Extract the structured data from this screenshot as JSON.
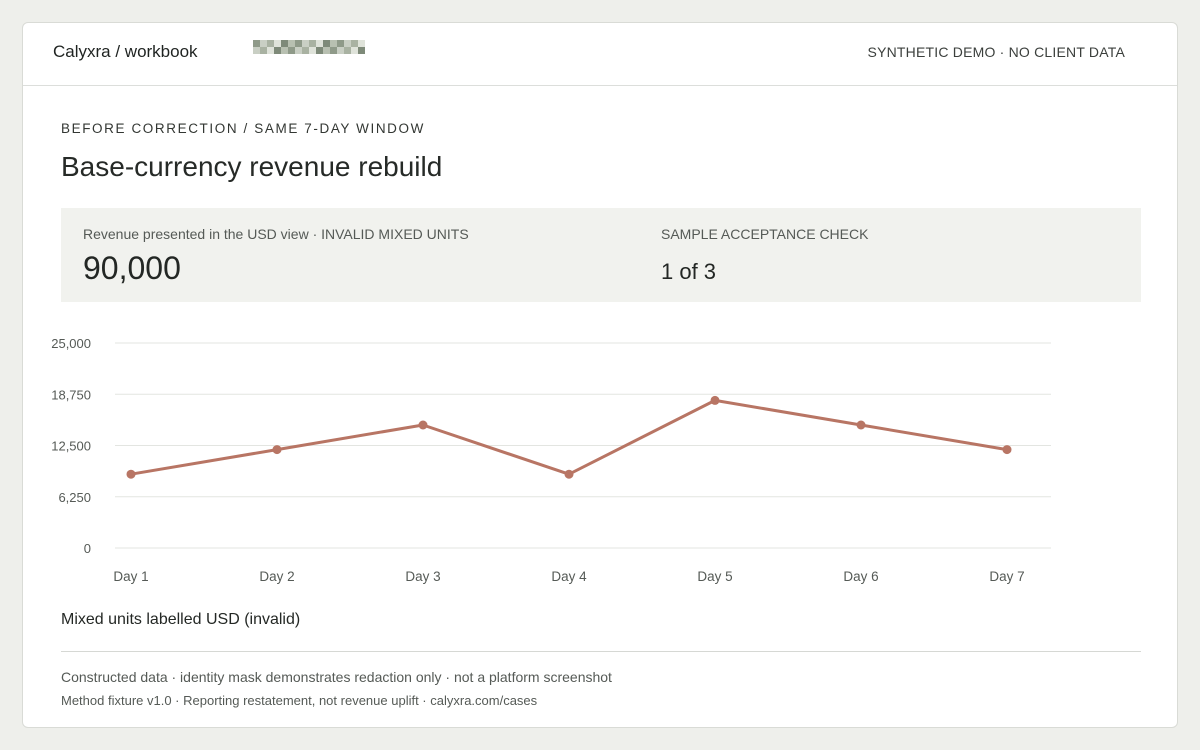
{
  "header": {
    "breadcrumb": "Calyxra / workbook",
    "badge": "SYNTHETIC DEMO · NO CLIENT DATA"
  },
  "page": {
    "eyebrow": "BEFORE CORRECTION / SAME 7-DAY WINDOW",
    "title": "Base-currency revenue rebuild"
  },
  "kpis": {
    "revenue_label": "Revenue presented in the USD view · INVALID MIXED UNITS",
    "revenue_value": "90,000",
    "check_label": "SAMPLE ACCEPTANCE CHECK",
    "check_value": "1 of 3"
  },
  "chart_data": {
    "type": "line",
    "x": [
      "Day 1",
      "Day 2",
      "Day 3",
      "Day 4",
      "Day 5",
      "Day 6",
      "Day 7"
    ],
    "series": [
      {
        "name": "Mixed units labelled USD (invalid)",
        "values": [
          9000,
          12000,
          15000,
          9000,
          18000,
          15000,
          12000
        ],
        "color": "#b87564"
      }
    ],
    "yticks": [
      "0",
      "6,250",
      "12,500",
      "18,750",
      "25,000"
    ],
    "ylim": [
      0,
      25000
    ],
    "grid": true,
    "legend": "bottom-left"
  },
  "footer": {
    "line1": "Constructed data · identity mask demonstrates redaction only · not a platform screenshot",
    "line2": "Method fixture v1.0 · Reporting restatement, not revenue uplift · calyxra.com/cases"
  }
}
